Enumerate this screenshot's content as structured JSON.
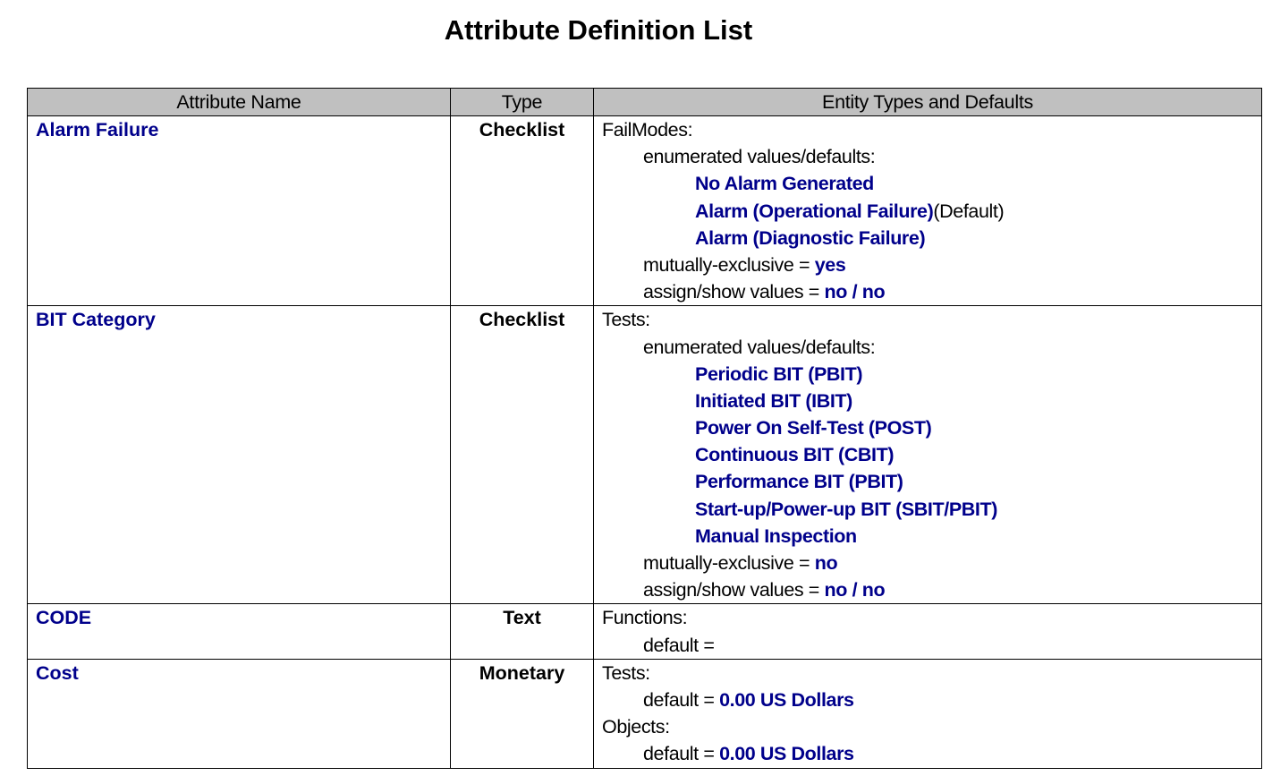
{
  "title": "Attribute Definition List",
  "columns": {
    "name": "Attribute Name",
    "type": "Type",
    "entities": "Entity Types and Defaults"
  },
  "rows": [
    {
      "name": "Alarm Failure",
      "type": "Checklist",
      "entity_type": "FailModes:",
      "enum_label": "enumerated values/defaults:",
      "values": [
        {
          "label": "No Alarm Generated",
          "suffix": ""
        },
        {
          "label": "Alarm (Operational Failure)",
          "suffix": "(Default)"
        },
        {
          "label": "Alarm (Diagnostic Failure)",
          "suffix": ""
        }
      ],
      "mutex_label": "mutually-exclusive = ",
      "mutex_value": "yes",
      "assign_label": "assign/show values = ",
      "assign_value": "no / no"
    },
    {
      "name": "BIT Category",
      "type": "Checklist",
      "entity_type": "Tests:",
      "enum_label": "enumerated values/defaults:",
      "values": [
        {
          "label": "Periodic BIT (PBIT)"
        },
        {
          "label": "Initiated BIT (IBIT)"
        },
        {
          "label": "Power On Self-Test (POST)"
        },
        {
          "label": "Continuous BIT (CBIT)"
        },
        {
          "label": "Performance BIT (PBIT)"
        },
        {
          "label": "Start-up/Power-up BIT (SBIT/PBIT)"
        },
        {
          "label": "Manual Inspection"
        }
      ],
      "mutex_label": "mutually-exclusive = ",
      "mutex_value": "no",
      "assign_label": "assign/show values = ",
      "assign_value": "no / no"
    },
    {
      "name": "CODE",
      "type": "Text",
      "entity_type": "Functions:",
      "default_label": "default = ",
      "default_value": ""
    },
    {
      "name": "Cost",
      "type": "Monetary",
      "entities": [
        {
          "entity_type": "Tests:",
          "default_label": "default = ",
          "default_value": "0.00 US Dollars"
        },
        {
          "entity_type": "Objects:",
          "default_label": "default = ",
          "default_value": "0.00 US Dollars"
        }
      ]
    }
  ]
}
